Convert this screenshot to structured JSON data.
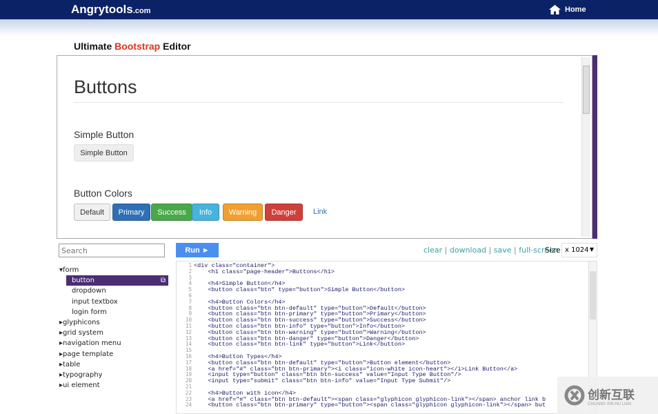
{
  "header": {
    "logo": "Angrytools",
    "logo_suffix": ".com",
    "home": "Home"
  },
  "title": {
    "part1": "Ultimate ",
    "part2": "Bootstrap",
    "part3": " Editor"
  },
  "preview": {
    "heading": "Buttons",
    "simple_heading": "Simple Button",
    "simple_button": "Simple Button",
    "colors_heading": "Button Colors",
    "buttons": [
      {
        "label": "Default",
        "bg": "#f0f0f0",
        "fg": "#333"
      },
      {
        "label": "Primary",
        "bg": "#2f6fb5",
        "fg": "#fff"
      },
      {
        "label": "Success",
        "bg": "#4aa84a",
        "fg": "#fff"
      },
      {
        "label": "Info",
        "bg": "#46b4dc",
        "fg": "#fff"
      },
      {
        "label": "Warning",
        "bg": "#f0a030",
        "fg": "#fff"
      },
      {
        "label": "Danger",
        "bg": "#d0403a",
        "fg": "#fff"
      }
    ],
    "link": "Link"
  },
  "sidebar": {
    "search_placeholder": "Search",
    "tree": [
      {
        "label": "form",
        "open": true,
        "children": [
          "button",
          "dropdown",
          "input textbox",
          "login form"
        ],
        "selected": "button"
      },
      {
        "label": "glyphicons"
      },
      {
        "label": "grid system"
      },
      {
        "label": "navigation menu"
      },
      {
        "label": "page template"
      },
      {
        "label": "table"
      },
      {
        "label": "typography"
      },
      {
        "label": "ui element"
      }
    ]
  },
  "toolbar": {
    "run": "Run ►",
    "clear": "clear",
    "download": "download",
    "save": "save",
    "fullscreen": "full-screen",
    "size_label": "Size",
    "size_value": "x 1024"
  },
  "editor": {
    "lines": [
      "<div class=\"container\">",
      "    <h1 class=\"page-header\">Buttons</h1>",
      "",
      "    <h4>Simple Button</h4>",
      "    <button class=\"btn\" type=\"button\">Simple Button</button>",
      "",
      "    <h4>Button Colors</h4>",
      "    <button class=\"btn btn-default\" type=\"button\">Default</button>",
      "    <button class=\"btn btn-primary\" type=\"button\">Primary</button>",
      "    <button class=\"btn btn-success\" type=\"button\">Success</button>",
      "    <button class=\"btn btn-info\" type=\"button\">Info</button>",
      "    <button class=\"btn btn-warning\" type=\"button\">Warning</button>",
      "    <button class=\"btn btn-danger\" type=\"button\">Danger</button>",
      "    <button class=\"btn btn-link\" type=\"button\">Link</button>",
      "",
      "    <h4>Button Types</h4>",
      "    <button class=\"btn btn-default\" type=\"button\">Button element</button>",
      "    <a href=\"#\" class=\"btn btn-primary\"><i class=\"icon-white icon-heart\"></i>Link Button</a>",
      "    <input type=\"button\" class=\"btn btn-success\" value=\"Input Type Button\"/>",
      "    <input type=\"submit\" class=\"btn btn-info\" value=\"Input Type Submit\"/>",
      "",
      "    <h4>Button with icon</h4>",
      "    <a href=\"#\" class=\"btn btn-default\"><span class=\"glyphicon glyphicon-link\"></span> anchor link b",
      "    <button class=\"btn btn-primary\" type=\"button\"><span class=\"glyphicon glyphicon-link\"></span> but"
    ]
  },
  "watermark": {
    "text": "创新互联",
    "sub": "CHUANG XIN HU LIAN"
  }
}
